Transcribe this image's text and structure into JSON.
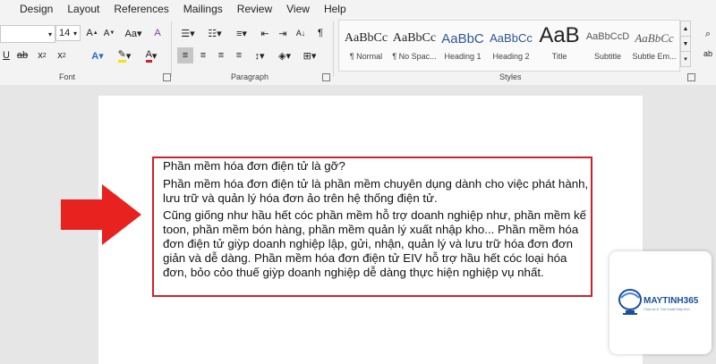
{
  "menu": {
    "items": [
      "Design",
      "Layout",
      "References",
      "Mailings",
      "Review",
      "View",
      "Help"
    ]
  },
  "font": {
    "size": "14",
    "group_label": "Font"
  },
  "paragraph": {
    "group_label": "Paragraph"
  },
  "styles": {
    "group_label": "Styles",
    "tiles": [
      {
        "sample": "AaBbCc",
        "name": "¶ Normal"
      },
      {
        "sample": "AaBbCc",
        "name": "¶ No Spac..."
      },
      {
        "sample": "AaBbC",
        "name": "Heading 1"
      },
      {
        "sample": "AaBbCc",
        "name": "Heading 2"
      },
      {
        "sample": "AaB",
        "name": "Title"
      },
      {
        "sample": "AaBbCcD",
        "name": "Subtitle"
      },
      {
        "sample": "AaBbCc",
        "name": "Subtle Em..."
      }
    ]
  },
  "document": {
    "paragraphs": [
      "Phần mềm hóa đơn điện tử là gỡ?",
      "Phần mềm hóa đơn điện tử là phần mềm chuyên dụng dành cho việc phát hành, lưu trữ và quản lý hóa đơn ảo trên hệ thống điện tử.",
      "Cũng giống như hầu hết cóc phần mềm hỗ trợ doanh nghiệp như, phần mềm kế toon, phần mềm bón hàng, phần mềm quản lý xuất nhập kho... Phần mềm hóa đơn điện tử giỳp doanh nghiệp lập, gửi, nhận, quản lý và lưu trữ hóa đơn đơn giản và dễ dàng. Phần mềm hóa đơn điện tử EIV hỗ trợ hầu hết cóc loại hóa đơn, bỏo cỏo thuế giỳp doanh nghiệp dễ dàng thực hiện nghiệp vụ nhất."
    ]
  },
  "logo": {
    "text": "MAYTINH365",
    "tagline": "Chia sẻ & Thủ thuật Máy tính"
  },
  "colors": {
    "highlight": "#d32027",
    "arrow": "#e8221f",
    "logo_blue": "#1a4e9c"
  }
}
